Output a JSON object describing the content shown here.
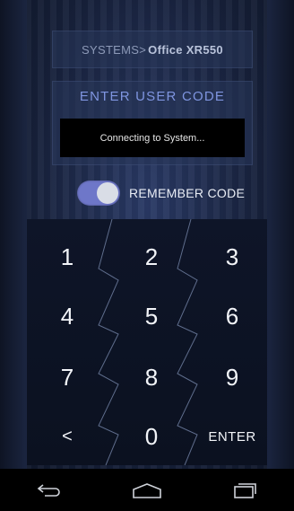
{
  "header": {
    "systems_prefix": "SYSTEMS>",
    "system_name": "Office XR550"
  },
  "code_entry": {
    "title": "ENTER USER CODE",
    "status": "Connecting to System..."
  },
  "remember": {
    "label": "REMEMBER CODE",
    "enabled": true
  },
  "keypad": {
    "keys": [
      "1",
      "2",
      "3",
      "4",
      "5",
      "6",
      "7",
      "8",
      "9",
      "<",
      "0",
      "ENTER"
    ]
  },
  "navigation": {
    "buttons": [
      "back-icon",
      "home-icon",
      "recent-apps-icon"
    ]
  },
  "colors": {
    "accent": "#7f95e0",
    "toggle_on": "#6e77c9",
    "background": "#17213b"
  }
}
